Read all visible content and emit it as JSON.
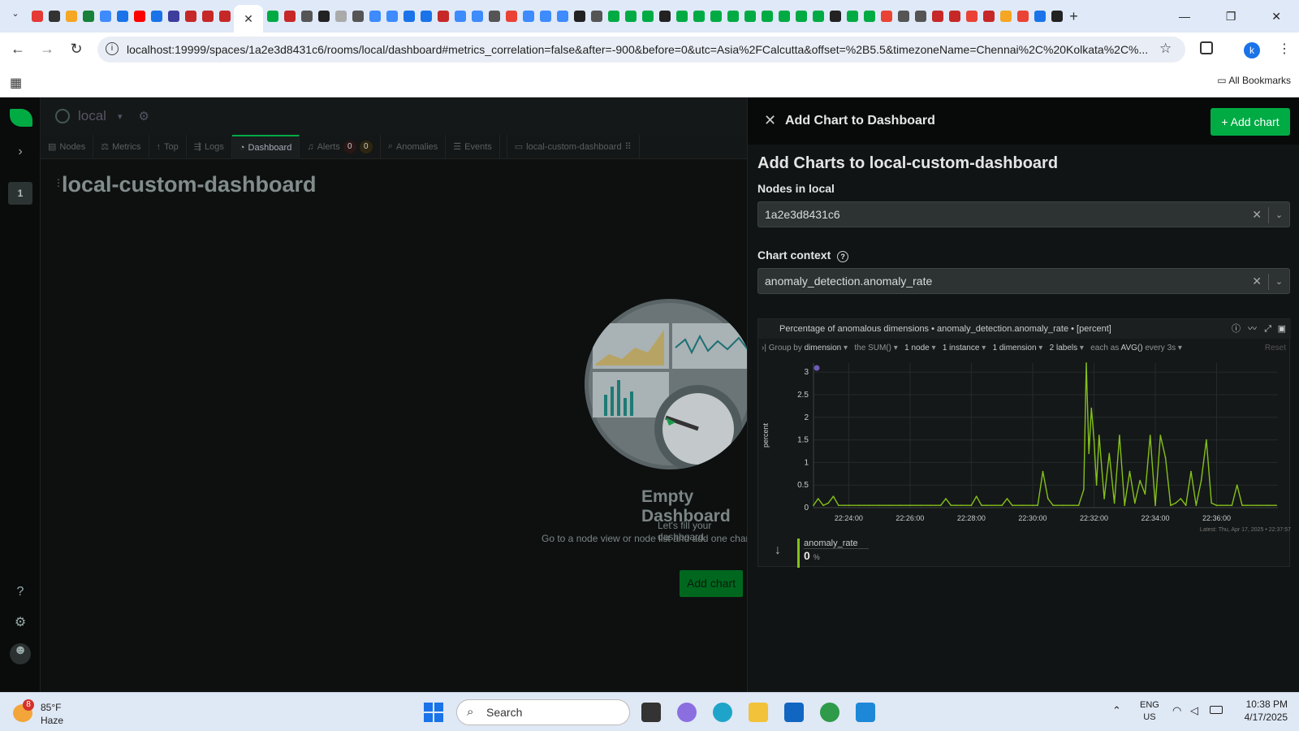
{
  "browser": {
    "url": "localhost:19999/spaces/1a2e3d8431c6/rooms/local/dashboard#metrics_correlation=false&after=-900&before=0&utc=Asia%2FCalcutta&offset=%2B5.5&timezoneName=Chennai%2C%20Kolkata%2C%...",
    "bookmarks_label": "All Bookmarks",
    "profile_initial": "k"
  },
  "app": {
    "room_name": "local",
    "space_badge": "1",
    "tabs": [
      {
        "label": "Nodes"
      },
      {
        "label": "Metrics"
      },
      {
        "label": "Top"
      },
      {
        "label": "Logs"
      },
      {
        "label": "Dashboard"
      },
      {
        "label": "Alerts"
      },
      {
        "label": "Anomalies"
      },
      {
        "label": "Events"
      },
      {
        "label": "local-custom-dashboard"
      }
    ],
    "alerts_critical": "0",
    "alerts_warning": "0",
    "dashboard_title": "local-custom-dashboard",
    "empty": {
      "title": "Empty Dashboard",
      "line1": "Let's fill your dashboard.",
      "line2": "Go to a node view or node list and add one chart to this l",
      "button": "Add chart"
    }
  },
  "panel": {
    "title": "Add Chart to Dashboard",
    "add_button": "Add chart",
    "heading": "Add Charts to local-custom-dashboard",
    "nodes_label": "Nodes in local",
    "nodes_value": "1a2e3d8431c6",
    "context_label": "Chart context",
    "context_value": "anomaly_detection.anomaly_rate"
  },
  "chart": {
    "header": "Percentage of anomalous dimensions • anomaly_detection.anomaly_rate • [percent]",
    "toolbar": {
      "group_by": "Group by",
      "group_by_value": "dimension",
      "agg": "the SUM()",
      "nodes": "1 node",
      "instances": "1 instance",
      "dimensions": "1 dimension",
      "labels": "2 labels",
      "each": "each as",
      "each_value": "AVG()",
      "every": "every 3s",
      "reset": "Reset"
    },
    "latest": "Latest: Thu, Apr 17, 2025 • 22:37:57",
    "legend_name": "anomaly_rate",
    "legend_value": "0",
    "legend_unit": "%"
  },
  "chart_data": {
    "type": "line",
    "ylabel": "percent",
    "ylim": [
      0,
      3.2
    ],
    "yticks": [
      "0",
      "0.5",
      "1",
      "1.5",
      "2",
      "2.5",
      "3"
    ],
    "xticks": [
      "22:24:00",
      "22:26:00",
      "22:28:00",
      "22:30:00",
      "22:32:00",
      "22:34:00",
      "22:36:00"
    ],
    "series": [
      {
        "name": "anomaly_rate",
        "color": "#84c01a",
        "x": [
          "22:22:51",
          "22:23:00",
          "22:23:10",
          "22:23:20",
          "22:23:30",
          "22:23:40",
          "22:23:50",
          "22:24:00",
          "22:24:20",
          "22:24:40",
          "22:25:00",
          "22:25:20",
          "22:25:40",
          "22:26:00",
          "22:26:20",
          "22:26:40",
          "22:27:00",
          "22:27:10",
          "22:27:20",
          "22:27:30",
          "22:27:40",
          "22:28:00",
          "22:28:10",
          "22:28:20",
          "22:28:30",
          "22:29:00",
          "22:29:10",
          "22:29:20",
          "22:29:40",
          "22:30:00",
          "22:30:10",
          "22:30:20",
          "22:30:30",
          "22:30:40",
          "22:31:00",
          "22:31:20",
          "22:31:30",
          "22:31:40",
          "22:31:45",
          "22:31:50",
          "22:31:55",
          "22:32:00",
          "22:32:05",
          "22:32:10",
          "22:32:20",
          "22:32:30",
          "22:32:40",
          "22:32:50",
          "22:33:00",
          "22:33:10",
          "22:33:20",
          "22:33:30",
          "22:33:40",
          "22:33:50",
          "22:34:00",
          "22:34:10",
          "22:34:20",
          "22:34:30",
          "22:34:40",
          "22:34:50",
          "22:35:00",
          "22:35:10",
          "22:35:20",
          "22:35:30",
          "22:35:40",
          "22:35:50",
          "22:36:00",
          "22:36:10",
          "22:36:20",
          "22:36:30",
          "22:36:40",
          "22:36:50",
          "22:37:00",
          "22:37:20",
          "22:37:40",
          "22:37:57"
        ],
        "values": [
          0.05,
          0.2,
          0.05,
          0.1,
          0.25,
          0.05,
          0.05,
          0.05,
          0.05,
          0.05,
          0.05,
          0.05,
          0.05,
          0.05,
          0.05,
          0.05,
          0.05,
          0.2,
          0.05,
          0.05,
          0.05,
          0.05,
          0.25,
          0.05,
          0.05,
          0.05,
          0.2,
          0.05,
          0.05,
          0.05,
          0.05,
          0.8,
          0.2,
          0.05,
          0.05,
          0.05,
          0.05,
          0.4,
          3.2,
          1.2,
          2.2,
          1.5,
          0.5,
          1.6,
          0.2,
          1.2,
          0.1,
          1.6,
          0.05,
          0.8,
          0.1,
          0.6,
          0.3,
          1.6,
          0.05,
          1.6,
          1.1,
          0.05,
          0.1,
          0.2,
          0.05,
          0.8,
          0.05,
          0.6,
          1.5,
          0.1,
          0.05,
          0.05,
          0.05,
          0.05,
          0.5,
          0.05,
          0.05,
          0.05,
          0.05,
          0.05
        ]
      }
    ]
  },
  "taskbar": {
    "temp": "85°F",
    "weather": "Haze",
    "weather_badge": "8",
    "search": "Search",
    "lang1": "ENG",
    "lang2": "US",
    "time": "10:38 PM",
    "date": "4/17/2025"
  },
  "colors": {
    "accent": "#00ab44",
    "panel_bg": "#111414",
    "line": "#84c01a"
  }
}
